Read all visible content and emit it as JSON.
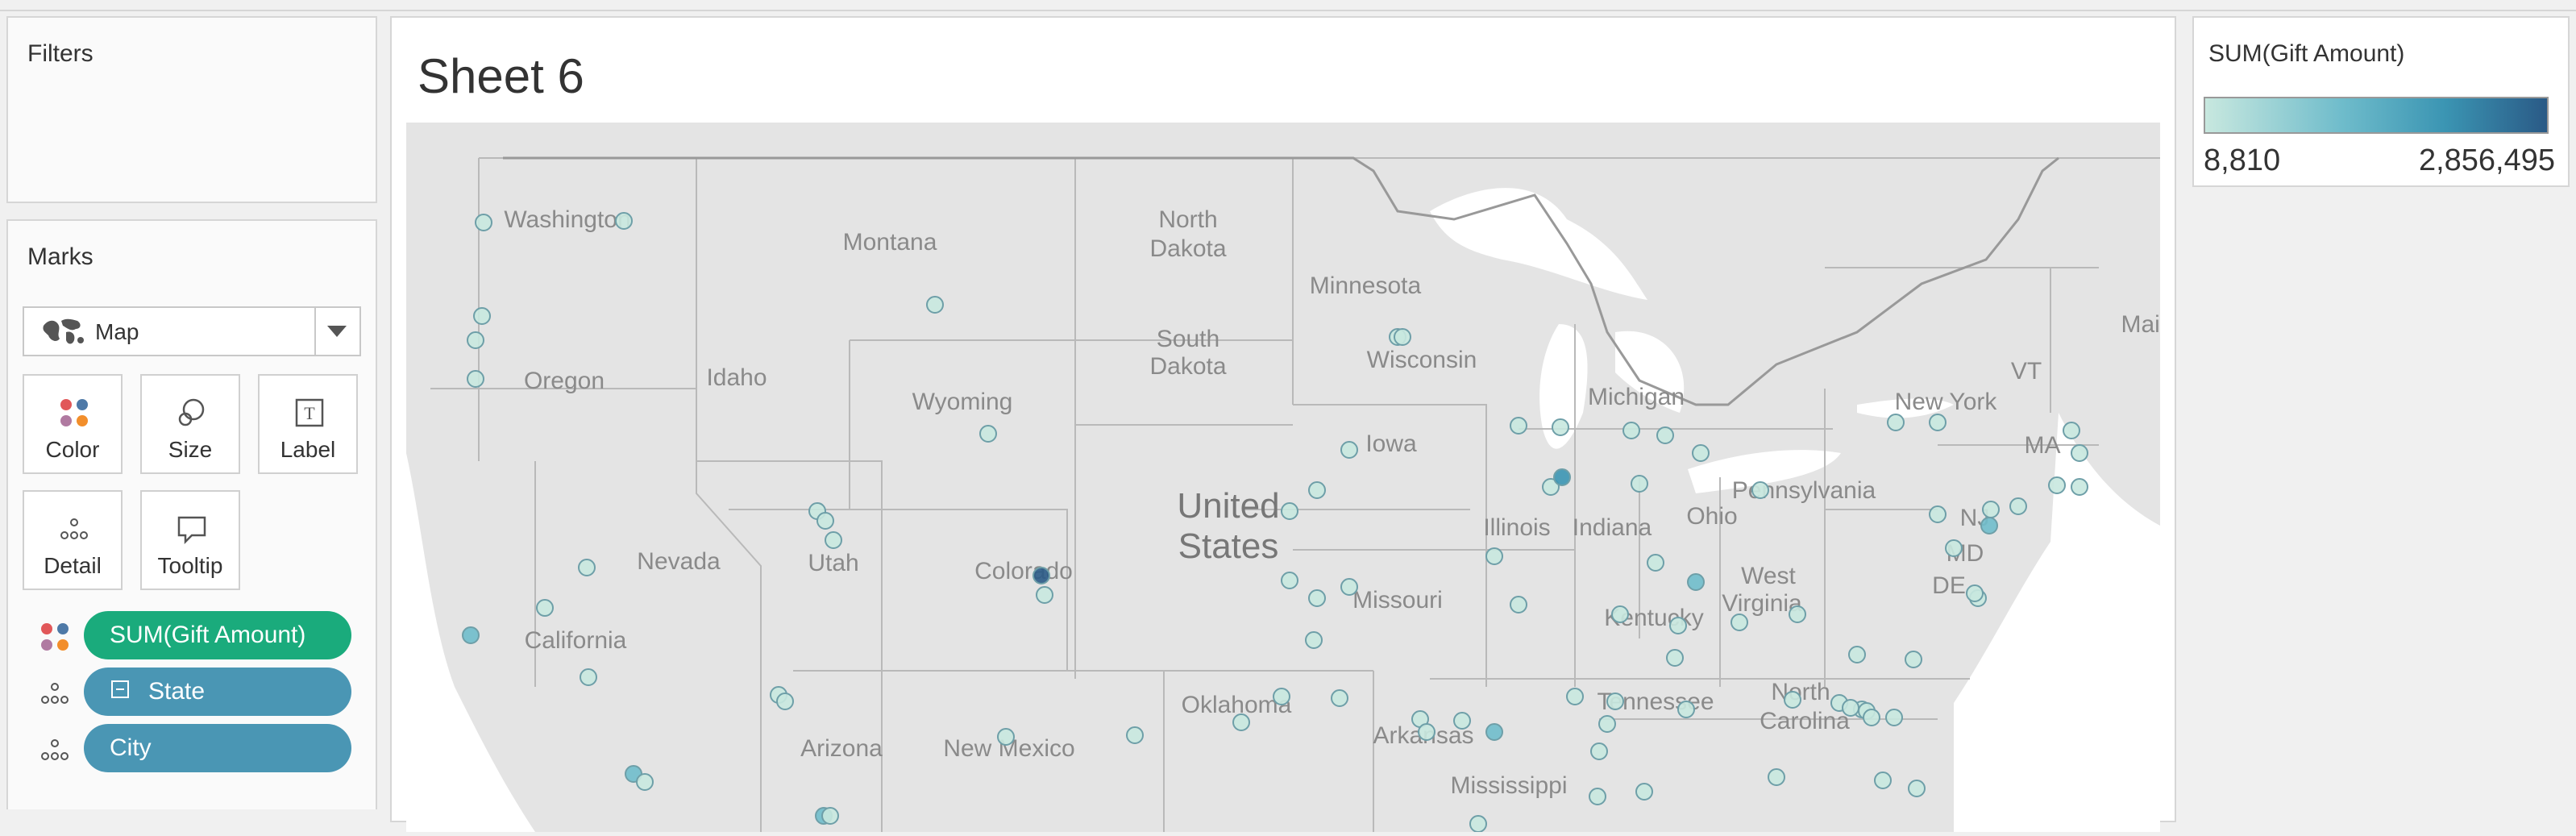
{
  "filters": {
    "title": "Filters"
  },
  "marks": {
    "title": "Marks",
    "mark_type": "Map",
    "cards": [
      {
        "label": "Color",
        "icon": "color-icon"
      },
      {
        "label": "Size",
        "icon": "size-icon"
      },
      {
        "label": "Label",
        "icon": "label-icon"
      },
      {
        "label": "Detail",
        "icon": "detail-icon"
      },
      {
        "label": "Tooltip",
        "icon": "tooltip-icon"
      }
    ],
    "pills": [
      {
        "label": "SUM(Gift Amount)",
        "color": "#1aab7c",
        "icon": "color-icon"
      },
      {
        "label": "State",
        "color": "#4a96b4",
        "icon": "detail-icon"
      },
      {
        "label": "City",
        "color": "#4a96b4",
        "icon": "detail-icon"
      }
    ]
  },
  "sheet": {
    "title": "Sheet 6"
  },
  "legend": {
    "title": "SUM(Gift Amount)",
    "min": "8,810",
    "max": "2,856,495",
    "colors": [
      "#c8e8df",
      "#6fbccb",
      "#3b95b3",
      "#2a5a86"
    ]
  },
  "map": {
    "country": [
      "United",
      "States"
    ],
    "states": [
      "Washington",
      "Montana",
      "North",
      "Dakota",
      "Minnesota",
      "Oregon",
      "Idaho",
      "South",
      "Dakota",
      "Wisconsin",
      "Michigan",
      "New York",
      "VT",
      "MA",
      "Main",
      "Wyoming",
      "Iowa",
      "Illinois",
      "Indiana",
      "Ohio",
      "Pennsylvania",
      "NJ",
      "Nevada",
      "Utah",
      "Colorado",
      "Missouri",
      "West",
      "Virginia",
      "MD",
      "DE",
      "Kentucky",
      "California",
      "Tennessee",
      "Oklahoma",
      "North",
      "Carolina",
      "Arkansas",
      "Arizona",
      "New Mexico",
      "Mississippi"
    ]
  }
}
